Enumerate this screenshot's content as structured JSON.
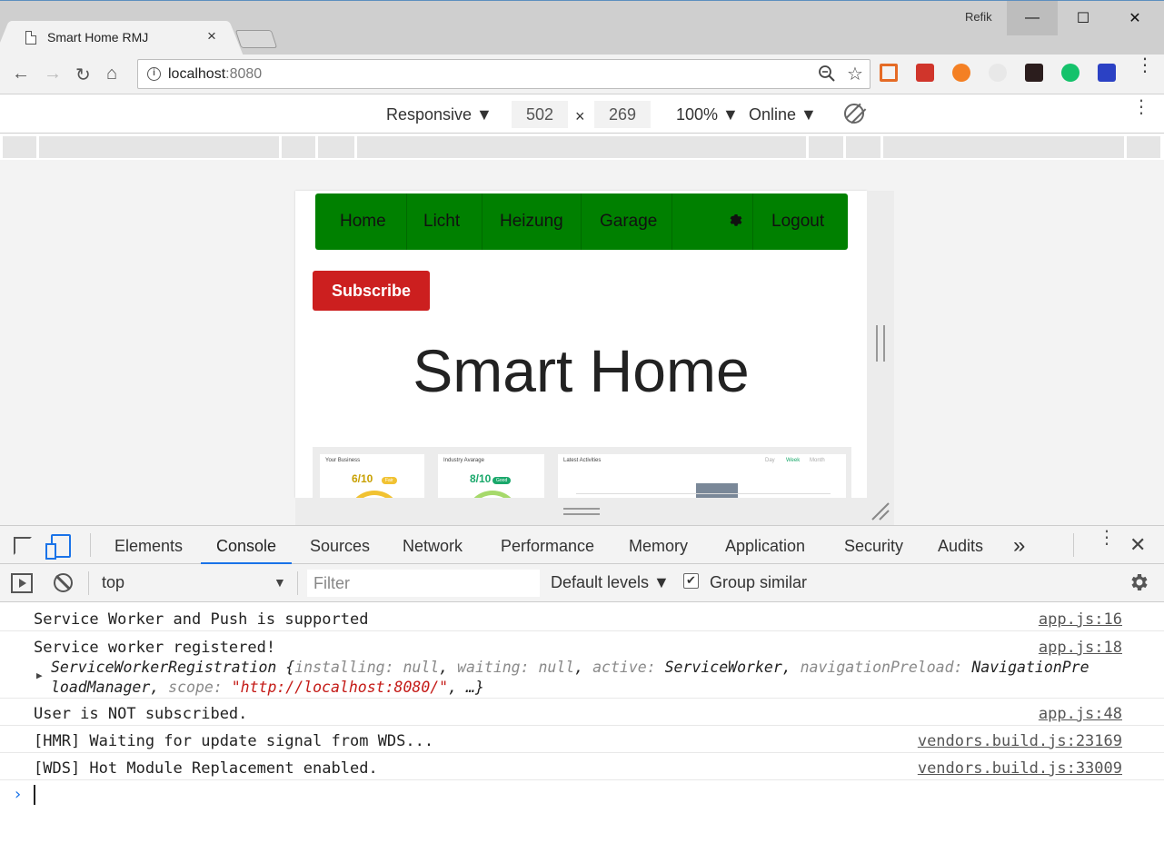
{
  "browser": {
    "tab_title": "Smart Home RMJ",
    "tab_close": "×",
    "profile_name": "Refik",
    "url_host": "localhost",
    "url_port": ":8080",
    "window_controls": {
      "minimize": "—",
      "maximize": "☐",
      "close": "✕"
    }
  },
  "device_toolbar": {
    "device": "Responsive ▼",
    "width": "502",
    "times": "×",
    "height": "269",
    "zoom": "100% ▼",
    "network": "Online ▼"
  },
  "site": {
    "nav": {
      "items": [
        "Home",
        "Licht",
        "Heizung",
        "Garage",
        "Logout"
      ],
      "bg_color": "#008000"
    },
    "subscribe_label": "Subscribe",
    "subscribe_color": "#cc1f1f",
    "title": "Smart Home",
    "preview": {
      "card1_title": "Your Business",
      "card1_score": "6/10",
      "card1_badge": "Fair",
      "card2_title": "Industry Avarage",
      "card2_score": "8/10",
      "card2_badge": "Good",
      "card3_title": "Latest Activities",
      "card3_tabs": [
        "Day",
        "Week",
        "Month"
      ]
    }
  },
  "devtools": {
    "tabs": [
      "Elements",
      "Console",
      "Sources",
      "Network",
      "Performance",
      "Memory",
      "Application",
      "Security",
      "Audits"
    ],
    "more_tabs": "»",
    "active_tab": "Console",
    "context": "top",
    "filter_placeholder": "Filter",
    "levels": "Default levels ▼",
    "group_similar": "Group similar",
    "group_similar_checked": true,
    "accent_color": "#1a73e8"
  },
  "console": {
    "messages": [
      {
        "text": "Service Worker and Push is supported",
        "source": "app.js:16"
      },
      {
        "text": "Service worker registered!",
        "source": "app.js:18"
      },
      {
        "text": "User is NOT subscribed.",
        "source": "app.js:48"
      },
      {
        "text": "[HMR] Waiting for update signal from WDS...",
        "source": "vendors.build.js:23169"
      },
      {
        "text": "[WDS] Hot Module Replacement enabled.",
        "source": "vendors.build.js:33009"
      }
    ],
    "object": {
      "class": "ServiceWorkerRegistration",
      "installing_key": "installing:",
      "installing_val": "null",
      "waiting_key": "waiting:",
      "waiting_val": "null",
      "active_key": "active:",
      "active_val": "ServiceWorker",
      "preload_key": "navigationPreload:",
      "preload_val_a": "NavigationPre",
      "preload_val_b": "loadManager",
      "scope_key": "scope:",
      "scope_val": "\"http://localhost:8080/\"",
      "ellipsis": "…}"
    },
    "prompt": "›"
  }
}
